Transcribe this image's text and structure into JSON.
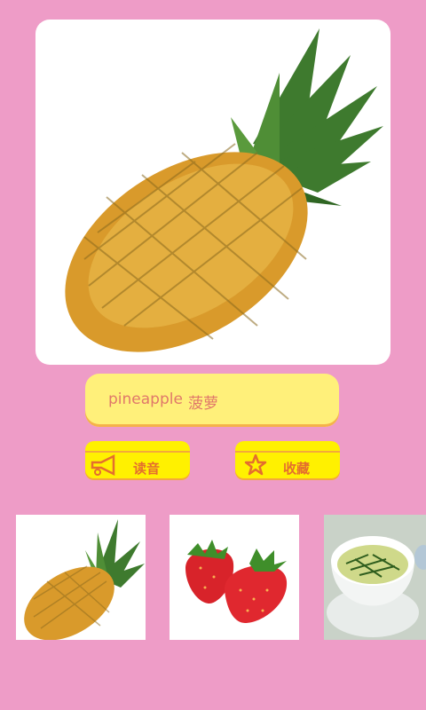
{
  "main_image": {
    "icon": "pineapple-image"
  },
  "word": {
    "english": "pineapple",
    "chinese": "菠萝"
  },
  "buttons": {
    "read_label": "读音",
    "read_icon": "megaphone-icon",
    "favorite_label": "收藏",
    "favorite_icon": "star-icon"
  },
  "thumbnails": [
    {
      "name": "pineapple",
      "icon": "pineapple-thumbnail"
    },
    {
      "name": "strawberry",
      "icon": "strawberry-thumbnail"
    },
    {
      "name": "green-tea",
      "icon": "tea-cup-thumbnail"
    }
  ],
  "colors": {
    "background": "#EE9CC7",
    "word_bar": "#FFF07A",
    "button": "#FFF100",
    "accent_text": "#E46E2E"
  }
}
